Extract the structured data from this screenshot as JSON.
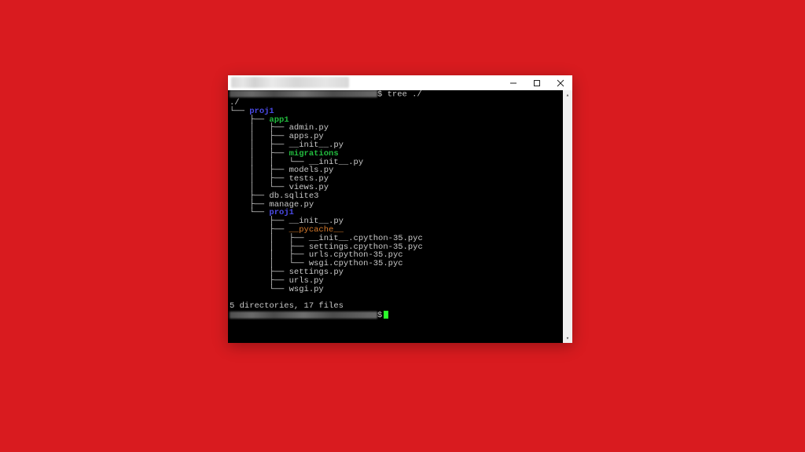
{
  "window": {
    "title_obscured": true
  },
  "prompt": {
    "symbol": "$",
    "command": "tree ./"
  },
  "tree": {
    "root": "./",
    "lines": [
      {
        "prefix": "└── ",
        "type": "dir",
        "name": "proj1"
      },
      {
        "prefix": "    ├── ",
        "type": "dir2",
        "name": "app1"
      },
      {
        "prefix": "    │   ├── ",
        "type": "file",
        "name": "admin.py"
      },
      {
        "prefix": "    │   ├── ",
        "type": "file",
        "name": "apps.py"
      },
      {
        "prefix": "    │   ├── ",
        "type": "file",
        "name": "__init__.py"
      },
      {
        "prefix": "    │   ├── ",
        "type": "dir2",
        "name": "migrations"
      },
      {
        "prefix": "    │   │   └── ",
        "type": "file",
        "name": "__init__.py"
      },
      {
        "prefix": "    │   ├── ",
        "type": "file",
        "name": "models.py"
      },
      {
        "prefix": "    │   ├── ",
        "type": "file",
        "name": "tests.py"
      },
      {
        "prefix": "    │   └── ",
        "type": "file",
        "name": "views.py"
      },
      {
        "prefix": "    ├── ",
        "type": "file",
        "name": "db.sqlite3"
      },
      {
        "prefix": "    ├── ",
        "type": "file",
        "name": "manage.py"
      },
      {
        "prefix": "    └── ",
        "type": "dir",
        "name": "proj1"
      },
      {
        "prefix": "        ├── ",
        "type": "file",
        "name": "__init__.py"
      },
      {
        "prefix": "        ├── ",
        "type": "dir3",
        "name": "__pycache__"
      },
      {
        "prefix": "        │   ├── ",
        "type": "file",
        "name": "__init__.cpython-35.pyc"
      },
      {
        "prefix": "        │   ├── ",
        "type": "file",
        "name": "settings.cpython-35.pyc"
      },
      {
        "prefix": "        │   ├── ",
        "type": "file",
        "name": "urls.cpython-35.pyc"
      },
      {
        "prefix": "        │   └── ",
        "type": "file",
        "name": "wsgi.cpython-35.pyc"
      },
      {
        "prefix": "        ├── ",
        "type": "file",
        "name": "settings.py"
      },
      {
        "prefix": "        ├── ",
        "type": "file",
        "name": "urls.py"
      },
      {
        "prefix": "        └── ",
        "type": "file",
        "name": "wsgi.py"
      }
    ],
    "summary": "5 directories, 17 files"
  },
  "classMap": {
    "dir": "dir",
    "dir2": "dir2",
    "dir3": "dir3",
    "file": "file"
  }
}
